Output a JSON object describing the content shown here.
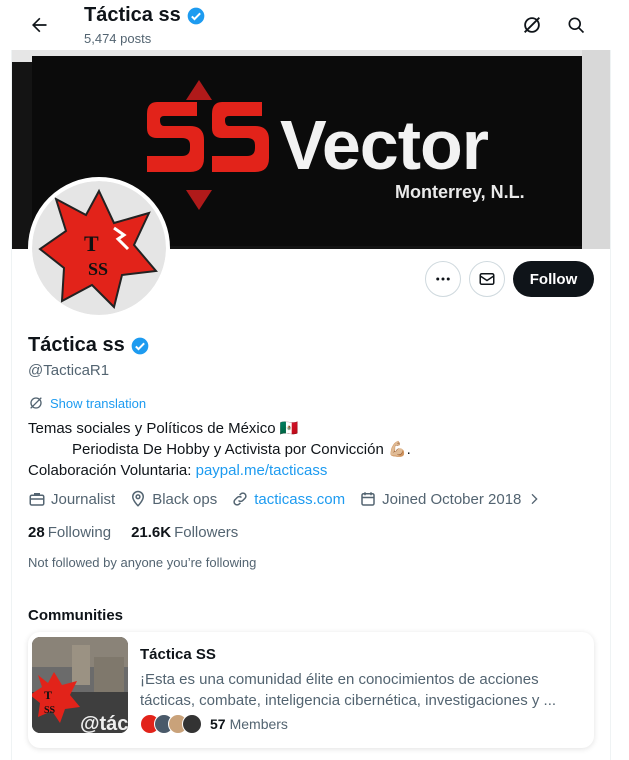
{
  "header": {
    "title": "Táctica ss",
    "posts": "5,474 posts"
  },
  "banner": {
    "brand": "Vector",
    "location": "Monterrey, N.L."
  },
  "avatar_logo": "T SS",
  "actions": {
    "follow_label": "Follow"
  },
  "profile": {
    "name": "Táctica ss",
    "handle": "@TacticaR1",
    "translate_label": "Show translation",
    "bio_line1": "Temas sociales y Políticos de México 🇲🇽",
    "bio_line2": "Periodista De Hobby y Activista por Convicción 💪🏼.",
    "bio_line3_prefix": "Colaboración Voluntaria: ",
    "bio_link": "paypal.me/tacticass",
    "category": "Journalist",
    "location": "Black ops",
    "website": "tacticass.com",
    "joined": "Joined October 2018",
    "following_count": "28",
    "following_label": "Following",
    "followers_count": "21.6K",
    "followers_label": "Followers",
    "not_followed": "Not followed by anyone you’re following"
  },
  "communities": {
    "title": "Communities",
    "items": [
      {
        "name": "Táctica SS",
        "description": "¡Esta es una comunidad élite en conocimientos de acciones tácticas, combate, inteligencia cibernética, investigaciones y ...",
        "members_count": "57",
        "members_label": "Members",
        "thumb_text": "@tác"
      }
    ]
  },
  "colors": {
    "accent": "#1d9bf0",
    "text": "#0f1419",
    "muted": "#536471",
    "verified": "#1d9bf0",
    "brand_red": "#e2231a"
  }
}
